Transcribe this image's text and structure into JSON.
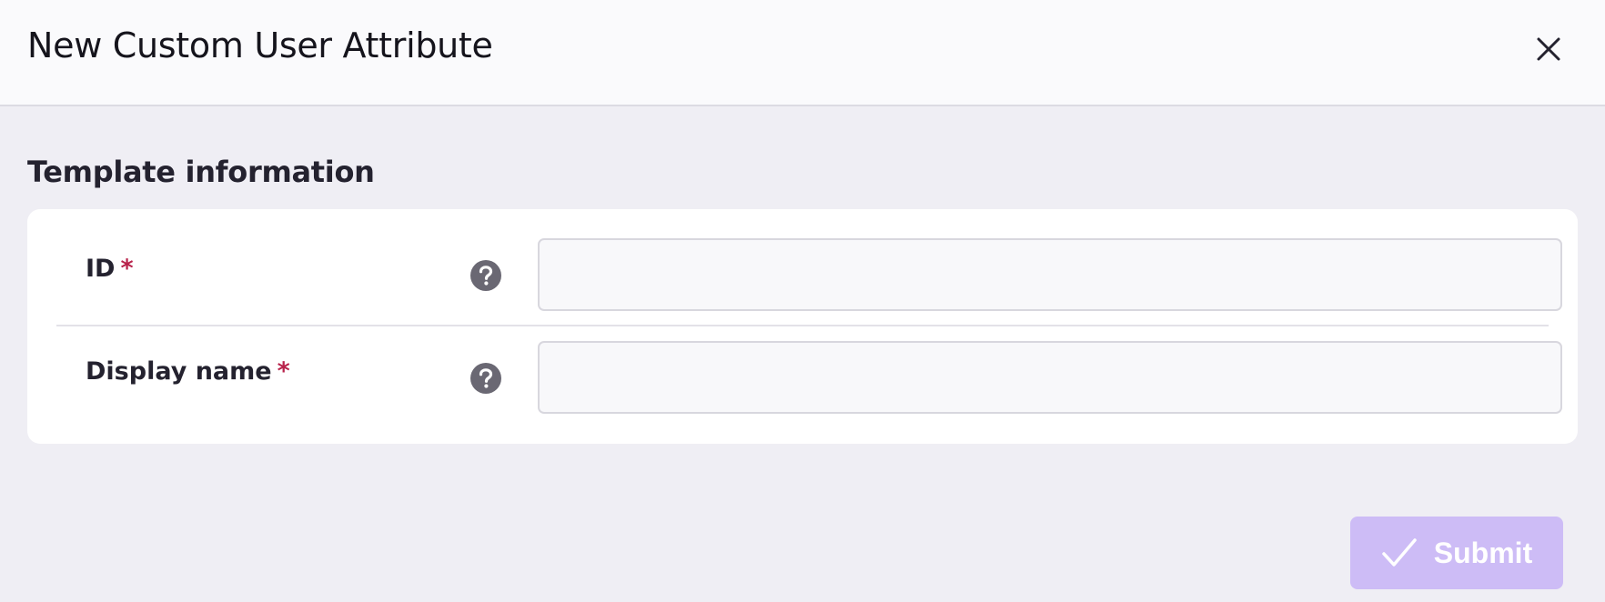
{
  "dialog": {
    "title": "New Custom User Attribute",
    "close_icon": "close-icon"
  },
  "section": {
    "title": "Template information"
  },
  "fields": [
    {
      "label": "ID",
      "required_marker": "*",
      "value": "",
      "placeholder": "",
      "help_icon": "help-icon"
    },
    {
      "label": "Display name",
      "required_marker": "*",
      "value": "",
      "placeholder": "",
      "help_icon": "help-icon"
    }
  ],
  "actions": {
    "submit_label": "Submit",
    "submit_icon": "check-icon",
    "submit_color": "#cdbcf6"
  },
  "colors": {
    "required": "#b8234b",
    "background": "#efeef4",
    "card": "#ffffff"
  }
}
